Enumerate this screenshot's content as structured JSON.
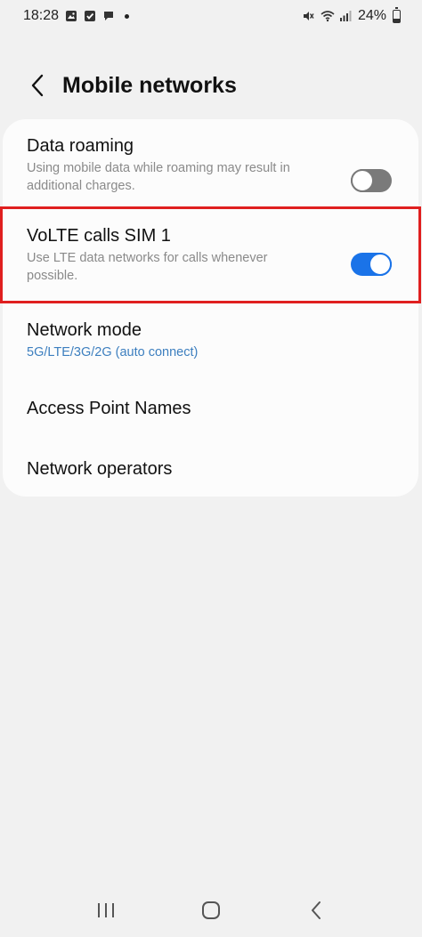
{
  "status_bar": {
    "time": "18:28",
    "battery_text": "24%",
    "battery_level": 0.24
  },
  "header": {
    "title": "Mobile networks"
  },
  "settings": {
    "data_roaming": {
      "title": "Data roaming",
      "description": "Using mobile data while roaming may result in additional charges.",
      "enabled": false
    },
    "volte": {
      "title": "VoLTE calls SIM 1",
      "description": "Use LTE data networks for calls whenever possible.",
      "enabled": true
    },
    "network_mode": {
      "title": "Network mode",
      "value": "5G/LTE/3G/2G (auto connect)"
    },
    "access_point_names": {
      "title": "Access Point Names"
    },
    "network_operators": {
      "title": "Network operators"
    }
  },
  "colors": {
    "accent": "#1a73e8",
    "highlight": "#e01f1f",
    "value_text": "#3d7fbf"
  }
}
